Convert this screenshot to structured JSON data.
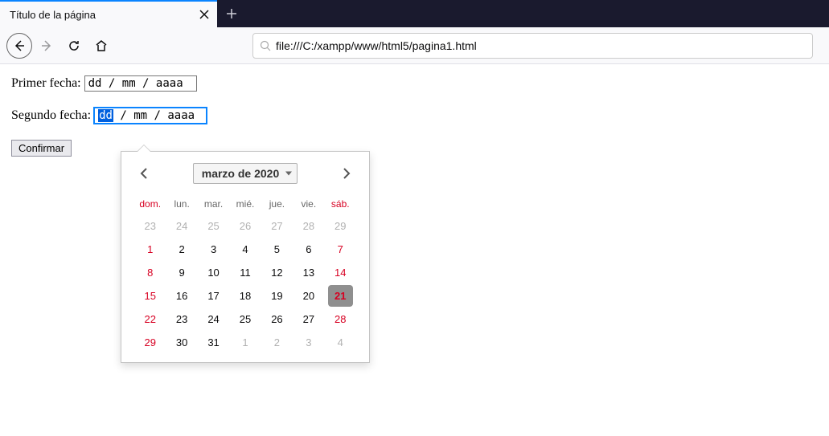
{
  "browser": {
    "tab_title": "Título de la página",
    "url": "file:///C:/xampp/www/html5/pagina1.html"
  },
  "form": {
    "label1": "Primer fecha:",
    "input1_placeholder": "dd / mm / aaaa",
    "label2": "Segundo fecha:",
    "input2_dd": "dd",
    "input2_rest": " / mm / aaaa",
    "submit": "Confirmar"
  },
  "datepicker": {
    "month_label": "marzo de 2020",
    "dow": [
      "dom.",
      "lun.",
      "mar.",
      "mié.",
      "jue.",
      "vie.",
      "sáb."
    ],
    "weeks": [
      [
        {
          "n": 23,
          "o": true,
          "w": true
        },
        {
          "n": 24,
          "o": true
        },
        {
          "n": 25,
          "o": true
        },
        {
          "n": 26,
          "o": true
        },
        {
          "n": 27,
          "o": true
        },
        {
          "n": 28,
          "o": true
        },
        {
          "n": 29,
          "o": true,
          "w": true
        }
      ],
      [
        {
          "n": 1,
          "w": true
        },
        {
          "n": 2
        },
        {
          "n": 3
        },
        {
          "n": 4
        },
        {
          "n": 5
        },
        {
          "n": 6
        },
        {
          "n": 7,
          "w": true
        }
      ],
      [
        {
          "n": 8,
          "w": true
        },
        {
          "n": 9
        },
        {
          "n": 10
        },
        {
          "n": 11
        },
        {
          "n": 12
        },
        {
          "n": 13
        },
        {
          "n": 14,
          "w": true
        }
      ],
      [
        {
          "n": 15,
          "w": true
        },
        {
          "n": 16
        },
        {
          "n": 17
        },
        {
          "n": 18
        },
        {
          "n": 19
        },
        {
          "n": 20
        },
        {
          "n": 21,
          "w": true,
          "today": true
        }
      ],
      [
        {
          "n": 22,
          "w": true
        },
        {
          "n": 23
        },
        {
          "n": 24
        },
        {
          "n": 25
        },
        {
          "n": 26
        },
        {
          "n": 27
        },
        {
          "n": 28,
          "w": true
        }
      ],
      [
        {
          "n": 29,
          "w": true
        },
        {
          "n": 30
        },
        {
          "n": 31
        },
        {
          "n": 1,
          "o": true
        },
        {
          "n": 2,
          "o": true
        },
        {
          "n": 3,
          "o": true
        },
        {
          "n": 4,
          "o": true,
          "w": true
        }
      ]
    ]
  }
}
